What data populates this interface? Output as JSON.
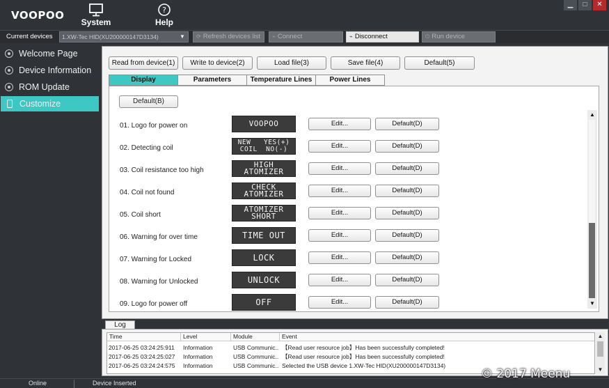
{
  "app": {
    "logo": "VOOPOO",
    "menu": [
      {
        "label": "System",
        "icon": "monitor-icon"
      },
      {
        "label": "Help",
        "icon": "help-icon"
      }
    ],
    "window_controls": {
      "minimize": "▁",
      "maximize": "□",
      "close": "✕"
    }
  },
  "device_bar": {
    "label": "Current devices",
    "selected_device": "1.XW-Tec HID(XU200000147D3134)",
    "buttons": [
      {
        "label": "Refresh devices list",
        "enabled": false
      },
      {
        "label": "Connect",
        "enabled": false
      },
      {
        "label": "Disconnect",
        "enabled": true
      },
      {
        "label": "Run device",
        "enabled": false
      }
    ]
  },
  "sidebar": {
    "items": [
      {
        "label": "Welcome Page",
        "active": false
      },
      {
        "label": "Device Information",
        "active": false
      },
      {
        "label": "ROM Update",
        "active": false
      },
      {
        "label": "Customize",
        "active": true
      }
    ]
  },
  "toolbar": {
    "read": "Read from device(1)",
    "write": "Write to device(2)",
    "load": "Load file(3)",
    "save": "Save file(4)",
    "default": "Default(5)"
  },
  "tabs": [
    {
      "label": "Display",
      "active": true
    },
    {
      "label": "Parameters",
      "active": false
    },
    {
      "label": "Temperature Lines",
      "active": false
    },
    {
      "label": "Power Lines",
      "active": false
    }
  ],
  "display": {
    "default_button": "Default(B)",
    "edit_label": "Edit...",
    "default_label": "Default(D)",
    "items": [
      {
        "label": "01. Logo for power on",
        "preview": "VOOPOO"
      },
      {
        "label": "02. Detecting coil",
        "preview": "NEW   YES(+)\nCOIL  NO(-)"
      },
      {
        "label": "03. Coil resistance too high",
        "preview": "HIGH\nATOMIZER"
      },
      {
        "label": "04. Coil not found",
        "preview": "CHECK\nATOMIZER"
      },
      {
        "label": "05. Coil short",
        "preview": "ATOMIZER\nSHORT"
      },
      {
        "label": "06. Warning for over time",
        "preview": "TIME OUT"
      },
      {
        "label": "07. Warning for Locked",
        "preview": "LOCK"
      },
      {
        "label": "08. Warning for Unlocked",
        "preview": "UNLOCK"
      },
      {
        "label": "09. Logo for power off",
        "preview": "OFF"
      }
    ]
  },
  "log": {
    "tab": "Log",
    "columns": [
      "Time",
      "Level",
      "Module",
      "Event"
    ],
    "rows": [
      [
        "2017-06-25 03:24:25:911",
        "Information",
        "USB Communic...",
        "【Read user resource job】Has been successfully completed!"
      ],
      [
        "2017-06-25 03:24:25:027",
        "Information",
        "USB Communic...",
        "【Read user resource job】Has been successfully completed!"
      ],
      [
        "2017-06-25 03:24:24:575",
        "Information",
        "USB Communic...",
        "Selected the USB device 1.XW-Tec HID(XU200000147D3134)"
      ]
    ]
  },
  "status": {
    "online": "Online",
    "device": "Device Inserted"
  },
  "watermark": "© 2017 Meenu",
  "colors": {
    "accent": "#3ec8c4",
    "chrome": "#2f3237"
  }
}
